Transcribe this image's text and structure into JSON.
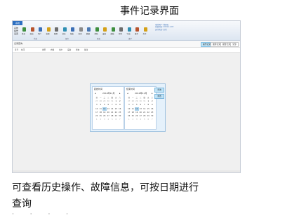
{
  "doc_title": "事件记录界面",
  "caption_line1": "可查看历史操作、故障信息，可按日期进行",
  "caption_line2": "查询",
  "caption_fragment": "· · · ·",
  "app": {
    "app_tab": "系统",
    "menu_left": [
      "系统",
      "操作",
      "设置"
    ],
    "ribbon_buttons": [
      {
        "label": "登录",
        "icon": "login-icon",
        "color": "#3f8f3f"
      },
      {
        "label": "退出",
        "icon": "logout-icon",
        "color": "#b8542d"
      },
      {
        "label": "用户",
        "icon": "user-icon",
        "color": "#3b6fb6"
      },
      {
        "label": "权限",
        "icon": "key-icon",
        "color": "#d4a017"
      },
      {
        "label": "配置",
        "icon": "settings-icon",
        "color": "#6d6d6d"
      },
      {
        "label": "记录",
        "icon": "record-icon",
        "color": "#2f8fb3"
      },
      {
        "label": "报表",
        "icon": "report-icon",
        "color": "#3b6fb6"
      },
      {
        "label": "查询",
        "icon": "search-icon",
        "color": "#8a8a8a"
      },
      {
        "label": "数据",
        "icon": "database-icon",
        "color": "#4a79b5"
      },
      {
        "label": "帮助",
        "icon": "help-icon",
        "color": "#3f8f3f"
      },
      {
        "label": "设备",
        "icon": "device-icon",
        "color": "#d4a017"
      },
      {
        "label": "曲线",
        "icon": "chart-icon",
        "color": "#3f8f3f"
      },
      {
        "label": "打印",
        "icon": "print-icon",
        "color": "#6d6d6d"
      },
      {
        "label": "导出",
        "icon": "export-icon",
        "color": "#2f8fb3"
      },
      {
        "label": "维护",
        "icon": "wrench-icon",
        "color": "#b8542d"
      },
      {
        "label": "关于",
        "icon": "about-icon",
        "color": "#d4a017"
      }
    ],
    "group_labels": [
      "系统",
      "操作",
      "报表",
      "维护"
    ],
    "info_lines": [
      "当前用户: 管理员",
      "系统时间: 2019-11-03",
      "运行状态: 正常"
    ],
    "toolbar_label": "记录查询",
    "toolbar_buttons": [
      {
        "label": "操作记录",
        "active": true
      },
      {
        "label": "故障记录",
        "active": false
      },
      {
        "label": "报警记录",
        "active": false
      },
      {
        "label": "全部",
        "active": false
      }
    ],
    "columns": [
      "序号",
      "时间",
      "类型",
      "内容",
      "用户",
      "设备",
      "状态",
      "备注"
    ],
    "dialog": {
      "start_title": "起始时间",
      "end_title": "结束时间",
      "month_label": "2019年11月",
      "prev": "◂",
      "next": "▸",
      "weekdays": [
        "日",
        "一",
        "二",
        "三",
        "四",
        "五",
        "六"
      ],
      "start_days": [
        [
          "27",
          "28",
          "29",
          "30",
          "31",
          "1",
          "2"
        ],
        [
          "3",
          "4",
          "5",
          "6",
          "7",
          "8",
          "9"
        ],
        [
          "10",
          "11",
          "12",
          "13",
          "14",
          "15",
          "16"
        ],
        [
          "17",
          "18",
          "19",
          "20",
          "21",
          "22",
          "23"
        ],
        [
          "24",
          "25",
          "26",
          "27",
          "28",
          "29",
          "30"
        ],
        [
          "1",
          "2",
          "3",
          "4",
          "5",
          "6",
          "7"
        ]
      ],
      "end_days": [
        [
          "27",
          "28",
          "29",
          "30",
          "31",
          "1",
          "2"
        ],
        [
          "3",
          "4",
          "5",
          "6",
          "7",
          "8",
          "9"
        ],
        [
          "10",
          "11",
          "12",
          "13",
          "14",
          "15",
          "16"
        ],
        [
          "17",
          "18",
          "19",
          "20",
          "21",
          "22",
          "23"
        ],
        [
          "24",
          "25",
          "26",
          "27",
          "28",
          "29",
          "30"
        ],
        [
          "1",
          "2",
          "3",
          "4",
          "5",
          "6",
          "7"
        ]
      ],
      "start_selected": "12",
      "end_selected": "12",
      "query_button": "查询",
      "reset_button": "重置"
    }
  }
}
